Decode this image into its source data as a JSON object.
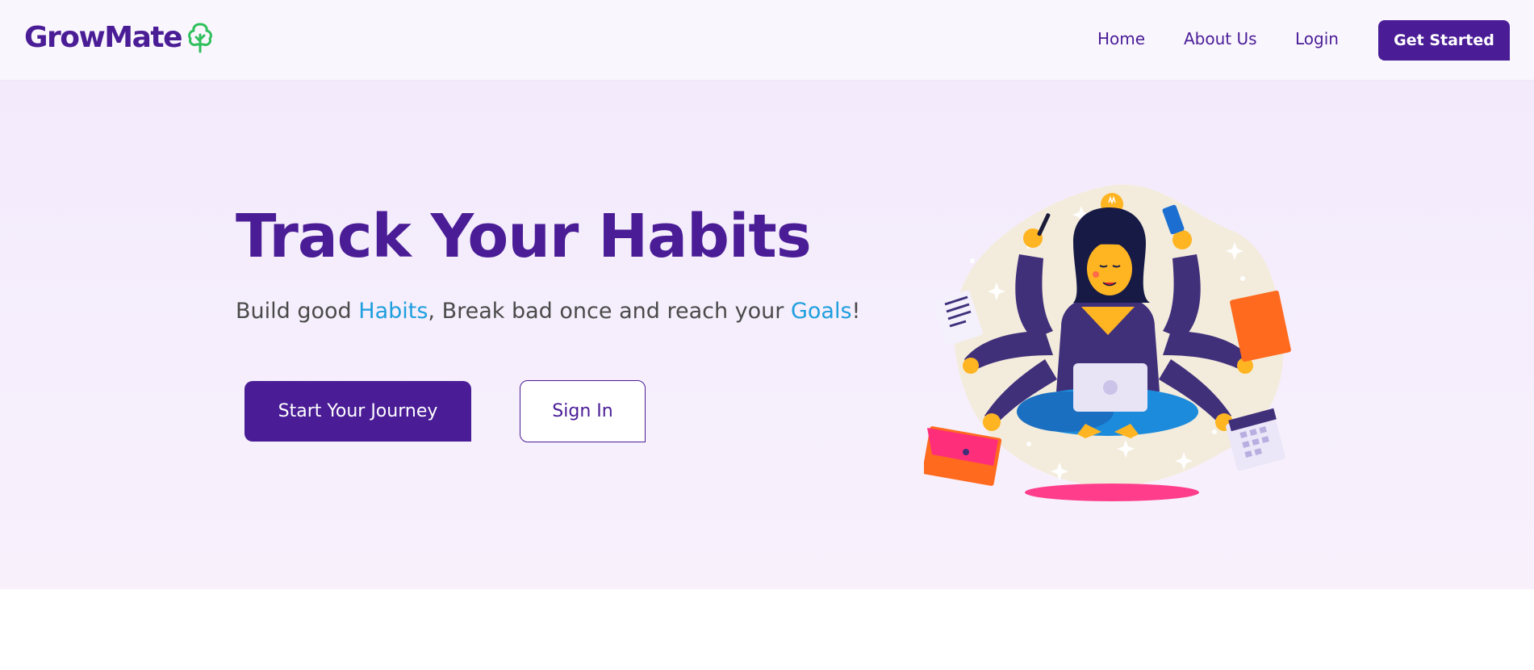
{
  "brand": {
    "name": "GrowMate",
    "icon": "tree-icon",
    "color": "#4a1d96",
    "icon_color": "#2fbf5b"
  },
  "nav": {
    "items": [
      {
        "label": "Home"
      },
      {
        "label": "About Us"
      },
      {
        "label": "Login"
      }
    ],
    "cta_label": "Get Started"
  },
  "hero": {
    "title": "Track Your Habits",
    "subtitle_parts": [
      "Build good ",
      "Habits",
      ", Break bad once and reach your ",
      "Goals",
      "!"
    ],
    "primary_button": "Start Your Journey",
    "secondary_button": "Sign In",
    "illustration": "multitasking-woman-illustration",
    "highlight_color": "#1e9fde"
  }
}
